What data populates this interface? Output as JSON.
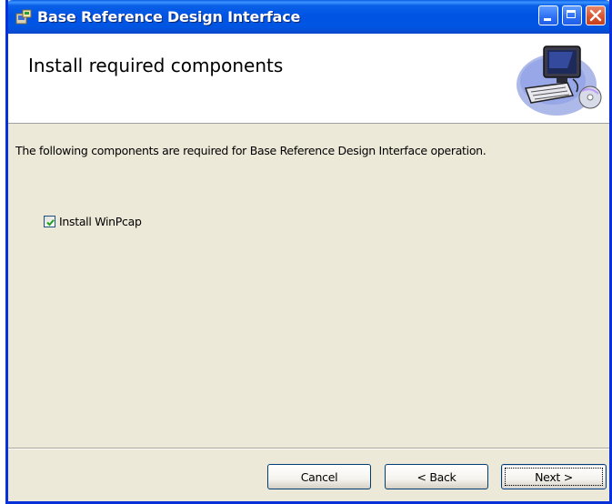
{
  "window": {
    "title": "Base Reference Design Interface",
    "controls": [
      "minimize",
      "maximize",
      "close"
    ]
  },
  "header": {
    "title": "Install required components",
    "graphic_icon": "computer-setup-icon"
  },
  "body": {
    "description": "The following components are required for Base Reference Design Interface operation.",
    "components": [
      {
        "label": "Install WinPcap",
        "checked": true
      }
    ]
  },
  "footer": {
    "cancel_label": "Cancel",
    "back_label": "< Back",
    "next_label": "Next >"
  },
  "colors": {
    "titlebar": "#0054e3",
    "window_bg": "#ece9d8",
    "close_button": "#d8512f"
  }
}
